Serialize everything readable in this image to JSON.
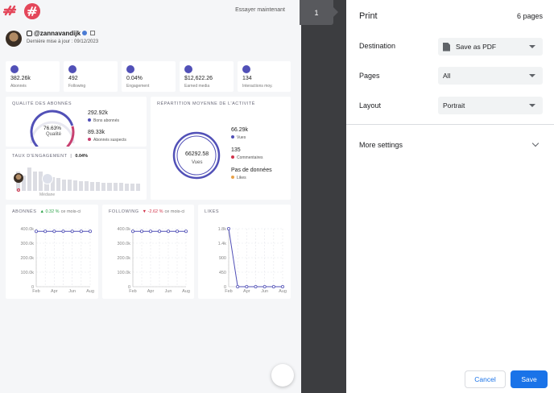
{
  "preview": {
    "page_number": "1",
    "header": {
      "try_now": "Essayer maintenant"
    },
    "profile": {
      "handle": "@zannavandijk",
      "updated": "Dernière mise à jour : 09/12/2023"
    },
    "stats": [
      {
        "value": "382.26k",
        "label": "Abonnés"
      },
      {
        "value": "492",
        "label": "Following"
      },
      {
        "value": "0.04%",
        "label": "Engagement"
      },
      {
        "value": "$12,622.26",
        "label": "Earned media"
      },
      {
        "value": "134",
        "label": "Interactions moy."
      }
    ],
    "quality": {
      "title": "QUALITÉ DES ABONNÉS",
      "percent": "76.63%",
      "percent_label": "Qualité",
      "good_value": "292.92k",
      "good_label": "Bons abonnés",
      "sus_value": "89.33k",
      "sus_label": "Abonnés suspects",
      "ratio": 0.7663
    },
    "engagement": {
      "title": "TAUX D'ENGAGEMENT",
      "value": "0.04%",
      "median_label": "Médiane"
    },
    "activity": {
      "title": "RÉPARTITION MOYENNE DE L'ACTIVITÉ",
      "center_value": "66292.58",
      "center_label": "Vues",
      "views_value": "66.29k",
      "views_label": "Vues",
      "comments_value": "135",
      "comments_label": "Commentaires",
      "likes_value": "Pas de données",
      "likes_label": "Likes"
    },
    "charts": {
      "abonnes": {
        "title": "ABONNÉS",
        "change": "▲ 0.32 %",
        "suffix": "ce mois-ci"
      },
      "following": {
        "title": "FOLLOWING",
        "change": "▼ -2.62 %",
        "suffix": "ce mois-ci"
      },
      "likes": {
        "title": "LIKES"
      }
    }
  },
  "chart_data": [
    {
      "type": "line",
      "title": "ABONNÉS",
      "x": [
        "Feb",
        "Mar",
        "Apr",
        "May",
        "Jun",
        "Jul",
        "Aug"
      ],
      "xticks": [
        "Feb",
        "Apr",
        "Jun",
        "Aug"
      ],
      "yticks": [
        "0",
        "100.0k",
        "200.0k",
        "300.0k",
        "400.0k"
      ],
      "ylim": [
        0,
        400000
      ],
      "series": [
        {
          "values": [
            382000,
            382000,
            382000,
            382000,
            382000,
            382000,
            382000
          ]
        }
      ],
      "color": "#5150b7"
    },
    {
      "type": "line",
      "title": "FOLLOWING",
      "x": [
        "Feb",
        "Mar",
        "Apr",
        "May",
        "Jun",
        "Jul",
        "Aug"
      ],
      "xticks": [
        "Feb",
        "Apr",
        "Jun",
        "Aug"
      ],
      "yticks": [
        "0",
        "100.0k",
        "200.0k",
        "300.0k",
        "400.0k"
      ],
      "ylim": [
        0,
        400000
      ],
      "series": [
        {
          "values": [
            382000,
            382000,
            382000,
            382000,
            382000,
            382000,
            382000
          ]
        }
      ],
      "color": "#5150b7"
    },
    {
      "type": "line",
      "title": "LIKES",
      "x": [
        "Feb",
        "Mar",
        "Apr",
        "May",
        "Jun",
        "Jul",
        "Aug"
      ],
      "xticks": [
        "Feb",
        "Apr",
        "Jun",
        "Aug"
      ],
      "yticks": [
        "0",
        "450",
        "900",
        "1.4k",
        "1.8k"
      ],
      "ylim": [
        0,
        1800
      ],
      "series": [
        {
          "values": [
            1800,
            0,
            0,
            0,
            0,
            0,
            0
          ]
        }
      ],
      "color": "#5150b7"
    }
  ],
  "engagement_bars": [
    0.72,
    0.55,
    0.86,
    0.72,
    0.7,
    0.62,
    0.5,
    0.46,
    0.42,
    0.4,
    0.38,
    0.36,
    0.34,
    0.33,
    0.32,
    0.3,
    0.3,
    0.29,
    0.28,
    0.27,
    0.26,
    0.26
  ],
  "print": {
    "title": "Print",
    "pages_count": "6 pages",
    "destination_label": "Destination",
    "destination_value": "Save as PDF",
    "pages_label": "Pages",
    "pages_value": "All",
    "layout_label": "Layout",
    "layout_value": "Portrait",
    "more_settings": "More settings",
    "cancel": "Cancel",
    "save": "Save"
  },
  "colors": {
    "accent": "#1a73e8",
    "brand": "#e4475a",
    "chart": "#5150b7",
    "separator": "#3c3d40"
  }
}
